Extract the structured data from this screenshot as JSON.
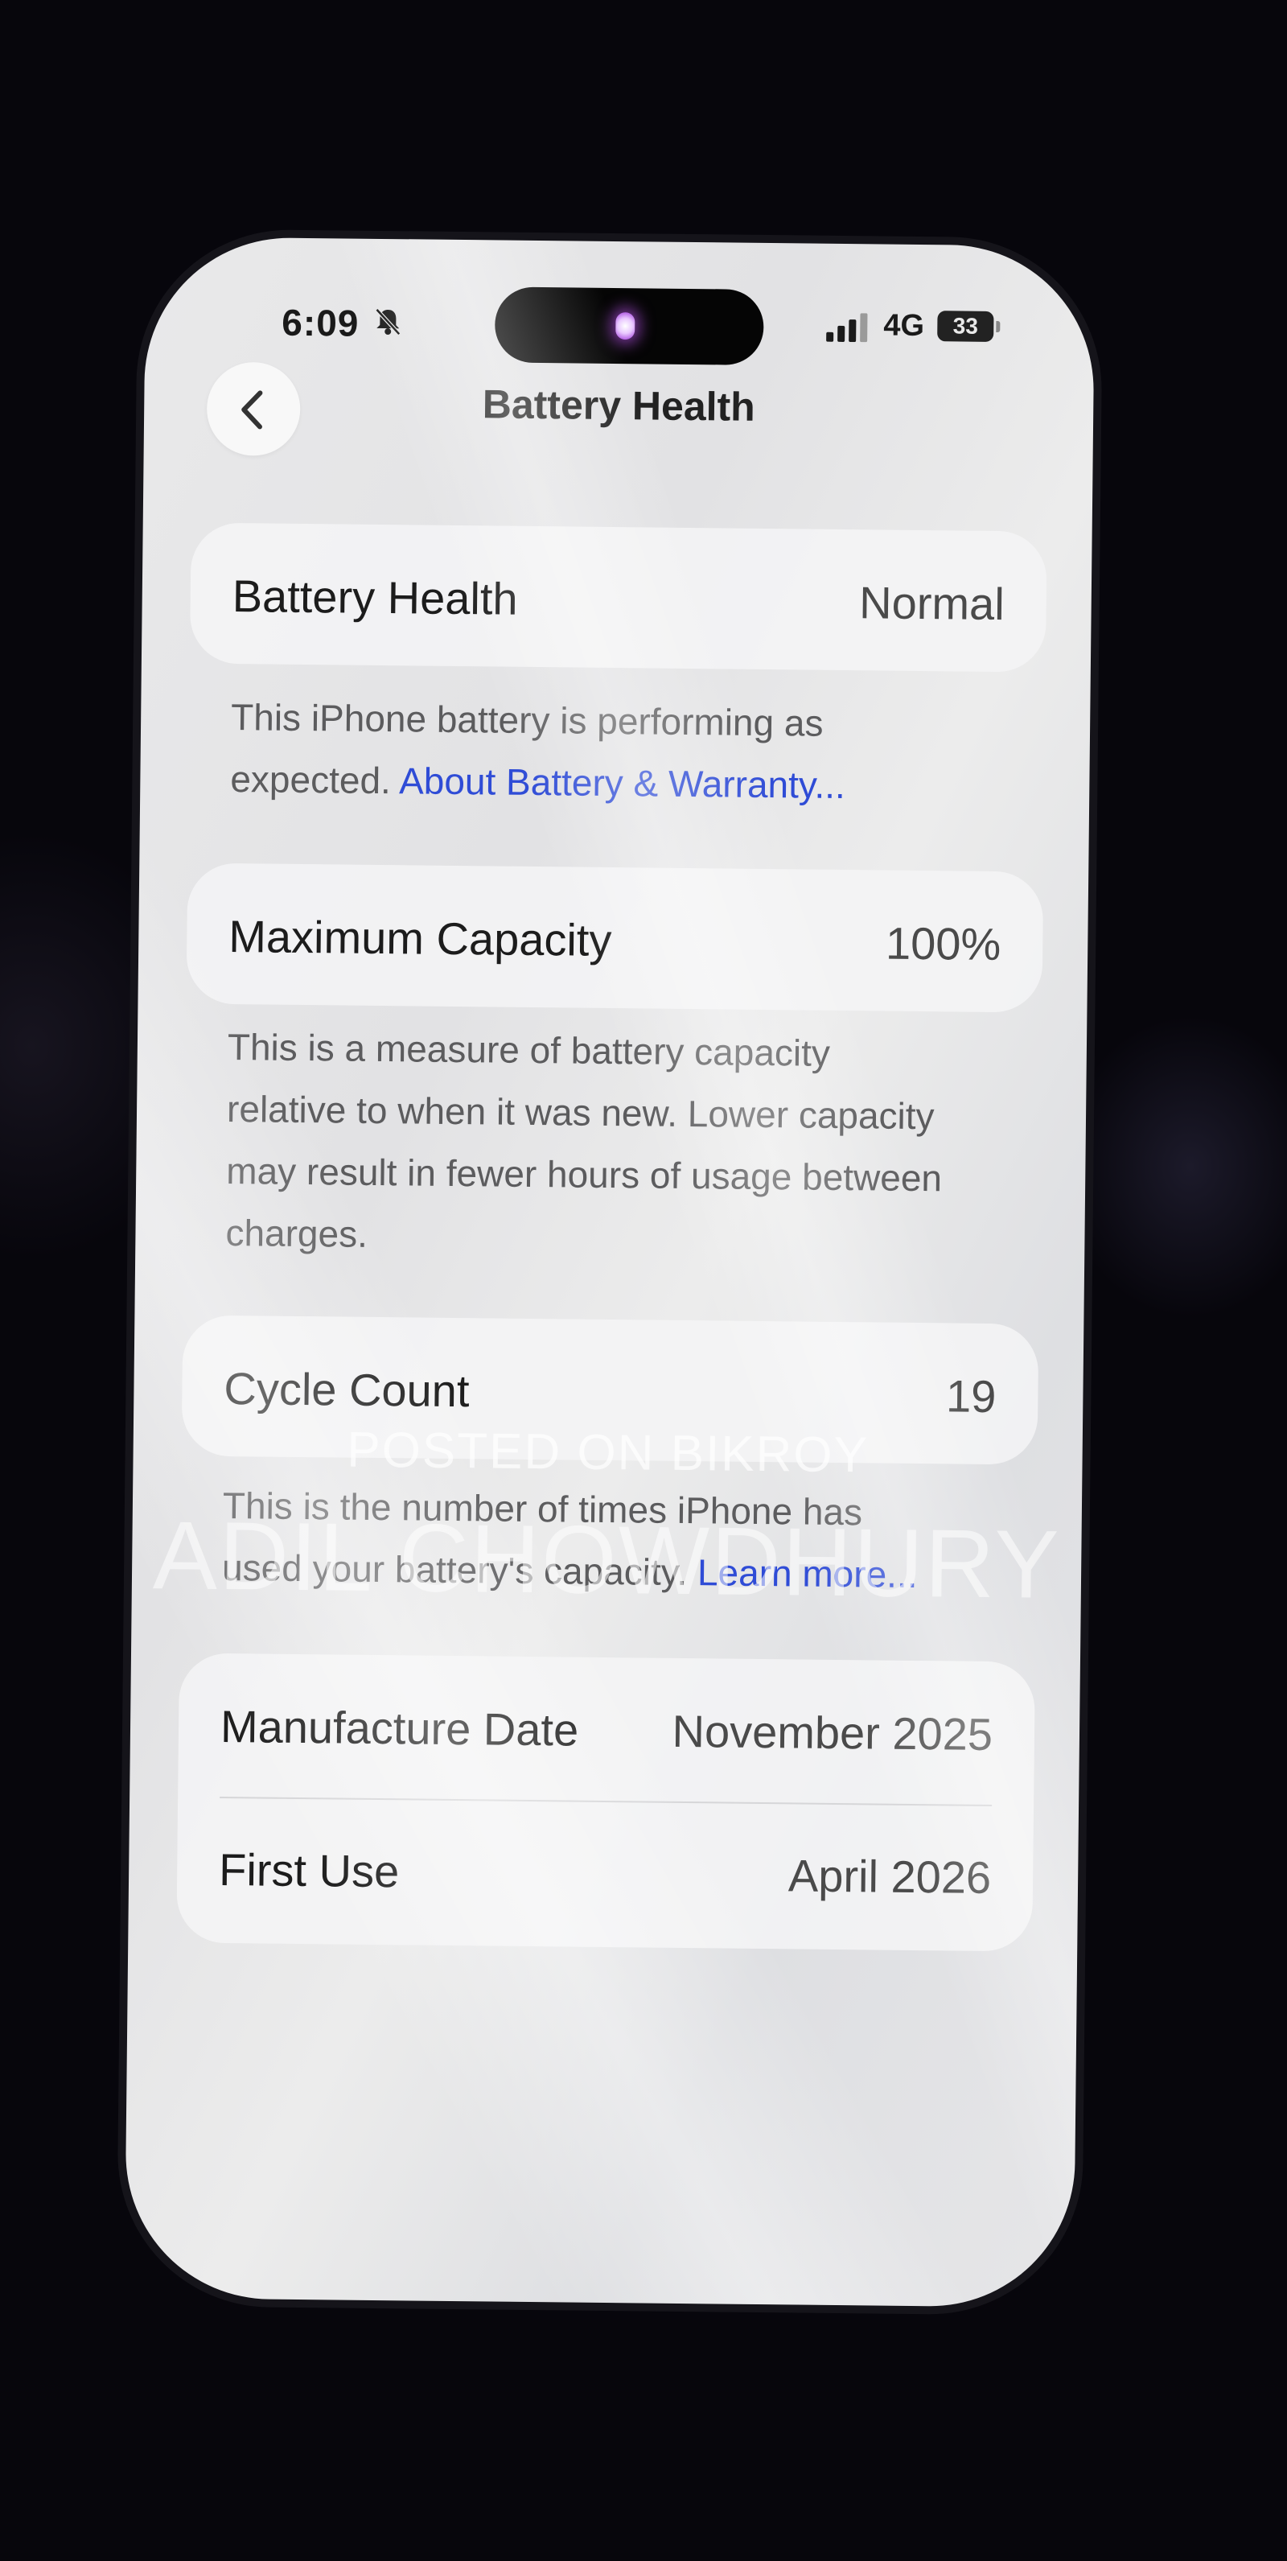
{
  "status_bar": {
    "time": "6:09",
    "network": "4G",
    "battery_level": "33",
    "icons": [
      "bell-slash-icon",
      "signal-icon",
      "battery-icon"
    ]
  },
  "nav": {
    "title": "Battery Health",
    "back_icon": "chevron-left-icon"
  },
  "battery_health": {
    "label": "Battery Health",
    "value": "Normal",
    "note_text": "This iPhone battery is performing as expected.",
    "note_link": "About Battery & Warranty..."
  },
  "max_capacity": {
    "label": "Maximum Capacity",
    "value": "100%",
    "note_text": "This is a measure of battery capacity relative to when it was new. Lower capacity may result in fewer hours of usage between charges."
  },
  "cycle_count": {
    "label": "Cycle Count",
    "value": "19",
    "note_text": "This is the number of times iPhone has used your battery's capacity.",
    "note_link": "Learn more..."
  },
  "dates": {
    "manufacture_label": "Manufacture Date",
    "manufacture_value": "November 2025",
    "first_use_label": "First Use",
    "first_use_value": "April 2026"
  },
  "watermark": {
    "line1": "POSTED ON BIKROY",
    "line2": "ADIL CHOWDHURY"
  },
  "colors": {
    "link": "#2f4cd6",
    "background": "#07060c"
  }
}
